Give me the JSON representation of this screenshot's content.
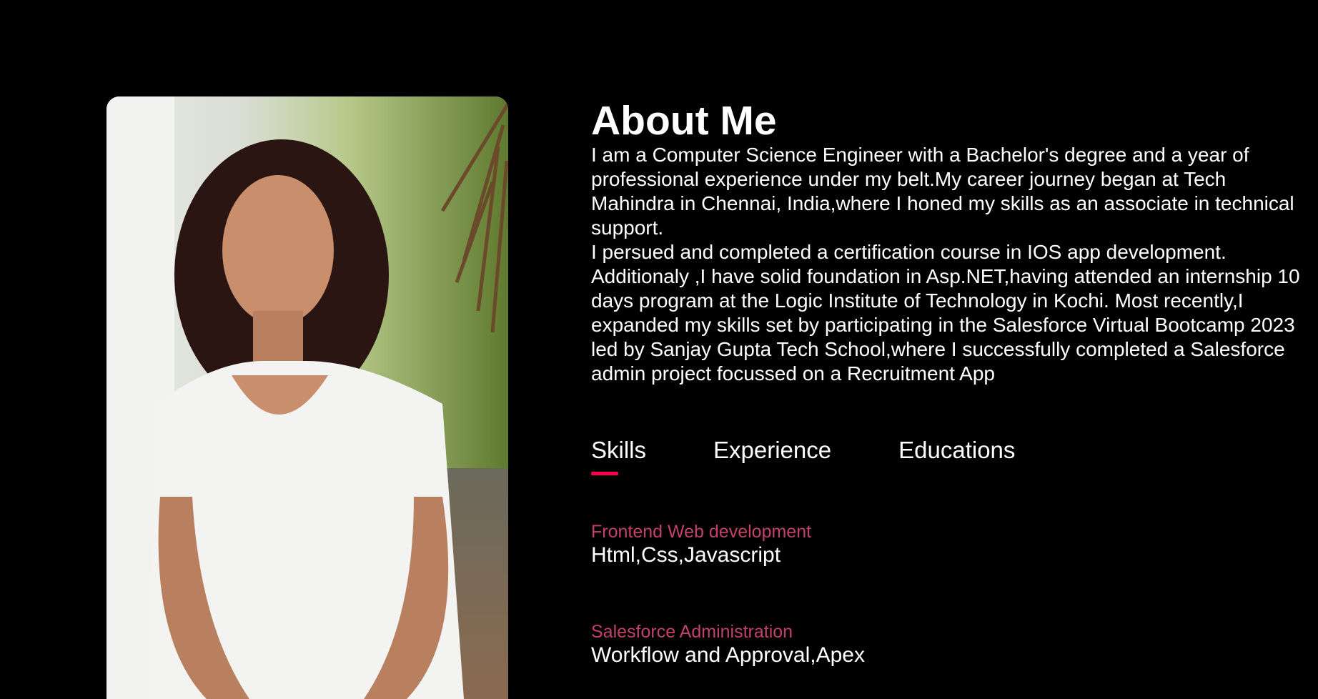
{
  "about": {
    "title": "About Me",
    "bio": "I am a Computer Science Engineer with a Bachelor's degree and a year of professional experience under my belt.My career journey began at Tech Mahindra in Chennai, India,where I honed my skills as an associate in technical support.\nI persued and completed a certification course in IOS app development. Additionaly ,I have solid foundation in Asp.NET,having attended an internship 10 days program at the Logic Institute of Technology in Kochi. Most recently,I expanded my skills set by participating in the Salesforce Virtual Bootcamp 2023 led by Sanjay Gupta Tech School,where I successfully completed a Salesforce admin project focussed on a Recruitment App"
  },
  "tabs": [
    {
      "label": "Skills",
      "active": true
    },
    {
      "label": "Experience",
      "active": false
    },
    {
      "label": "Educations",
      "active": false
    }
  ],
  "skills": [
    {
      "title": "Frontend Web development",
      "value": "Html,Css,Javascript"
    },
    {
      "title": "Salesforce Administration",
      "value": "Workflow and Approval,Apex"
    }
  ],
  "colors": {
    "background": "#000000",
    "accent": "#ff004f",
    "skill_title": "#c2416a",
    "text": "#ffffff"
  }
}
